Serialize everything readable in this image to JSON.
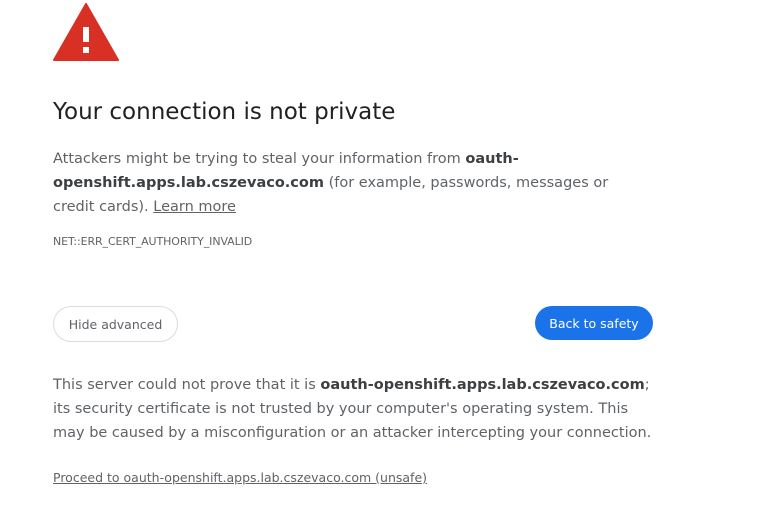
{
  "icon": {
    "name": "warning-triangle-icon",
    "color": "#d93025"
  },
  "title": "Your connection is not private",
  "main_message": {
    "prefix": "Attackers might be trying to steal your information from ",
    "domain": "oauth-openshift.apps.lab.cszevaco.com",
    "suffix": " (for example, passwords, messages or credit cards). ",
    "learn_more": "Learn more"
  },
  "error_code": "NET::ERR_CERT_AUTHORITY_INVALID",
  "buttons": {
    "hide_advanced": "Hide advanced",
    "back_to_safety": "Back to safety"
  },
  "details": {
    "prefix": "This server could not prove that it is ",
    "domain": "oauth-openshift.apps.lab.cszevaco.com",
    "suffix": "; its security certificate is not trusted by your computer's operating system. This may be caused by a misconfiguration or an attacker intercepting your connection."
  },
  "proceed_link": "Proceed to oauth-openshift.apps.lab.cszevaco.com (unsafe)",
  "colors": {
    "accent": "#1a73e8",
    "danger": "#d93025",
    "text_primary": "#202124",
    "text_secondary": "#5f6368"
  }
}
